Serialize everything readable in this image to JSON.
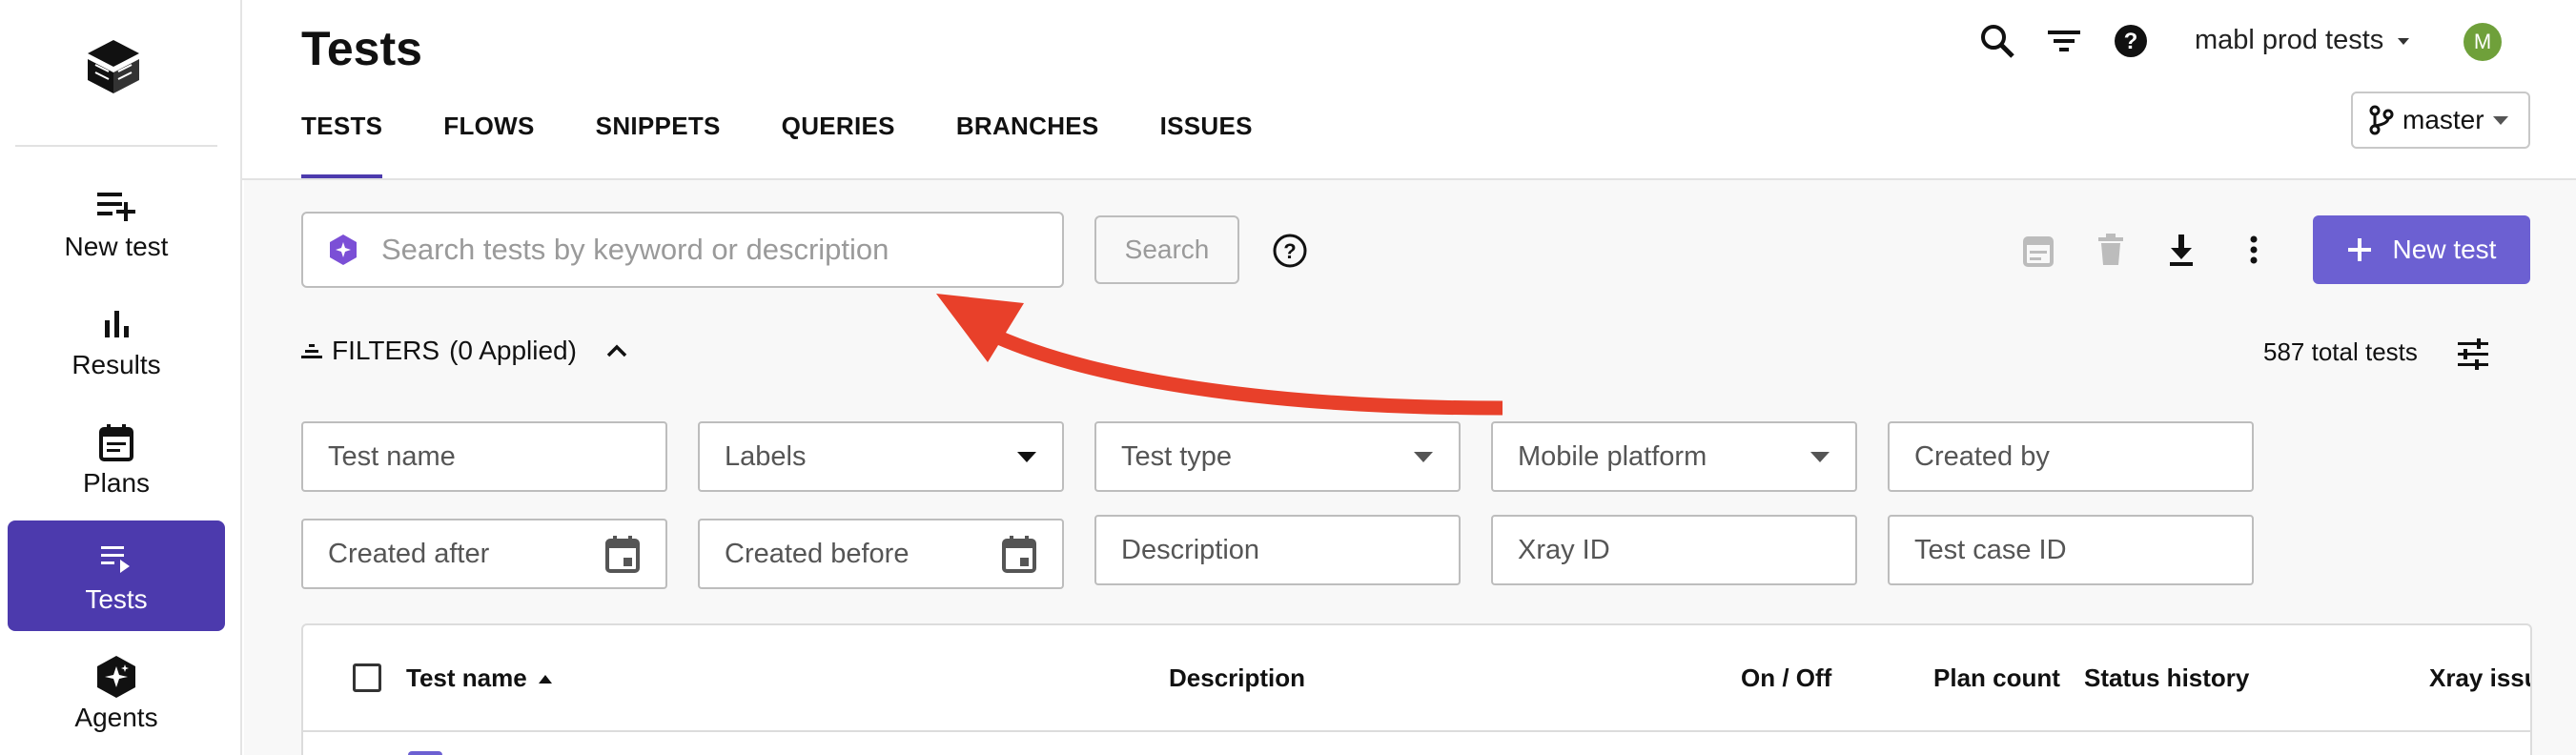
{
  "sidebar": {
    "items": [
      {
        "label": "New test",
        "icon": "playlist-add-icon"
      },
      {
        "label": "Results",
        "icon": "bar-chart-icon"
      },
      {
        "label": "Plans",
        "icon": "calendar-icon"
      },
      {
        "label": "Tests",
        "icon": "playlist-play-icon",
        "active": true
      },
      {
        "label": "Agents",
        "icon": "sparkle-hex-icon"
      }
    ]
  },
  "header": {
    "title": "Tests",
    "workspace": "mabl prod tests",
    "avatar_initial": "M",
    "branch": "master",
    "tabs": [
      "TESTS",
      "FLOWS",
      "SNIPPETS",
      "QUERIES",
      "BRANCHES",
      "ISSUES"
    ]
  },
  "search": {
    "placeholder": "Search tests by keyword or description",
    "button_label": "Search"
  },
  "toolbar": {
    "new_test_label": "New test"
  },
  "filters": {
    "toggle_label": "FILTERS",
    "applied_label": "(0 Applied)",
    "total_tests": "587 total tests",
    "fields": [
      {
        "label": "Test name",
        "kind": "text"
      },
      {
        "label": "Labels",
        "kind": "select"
      },
      {
        "label": "Test type",
        "kind": "select"
      },
      {
        "label": "Mobile platform",
        "kind": "select"
      },
      {
        "label": "Created by",
        "kind": "text"
      },
      {
        "label": "Created after",
        "kind": "date"
      },
      {
        "label": "Created before",
        "kind": "date"
      },
      {
        "label": "Description",
        "kind": "text"
      },
      {
        "label": "Xray ID",
        "kind": "text"
      },
      {
        "label": "Test case ID",
        "kind": "text"
      }
    ]
  },
  "table": {
    "columns": [
      "Test name",
      "Description",
      "On / Off",
      "Plan count",
      "Status history",
      "Xray issu"
    ]
  },
  "colors": {
    "accent": "#4c3aad",
    "button": "#6c60d2",
    "annotation_arrow": "#e8402a",
    "avatar": "#6fa03a"
  }
}
